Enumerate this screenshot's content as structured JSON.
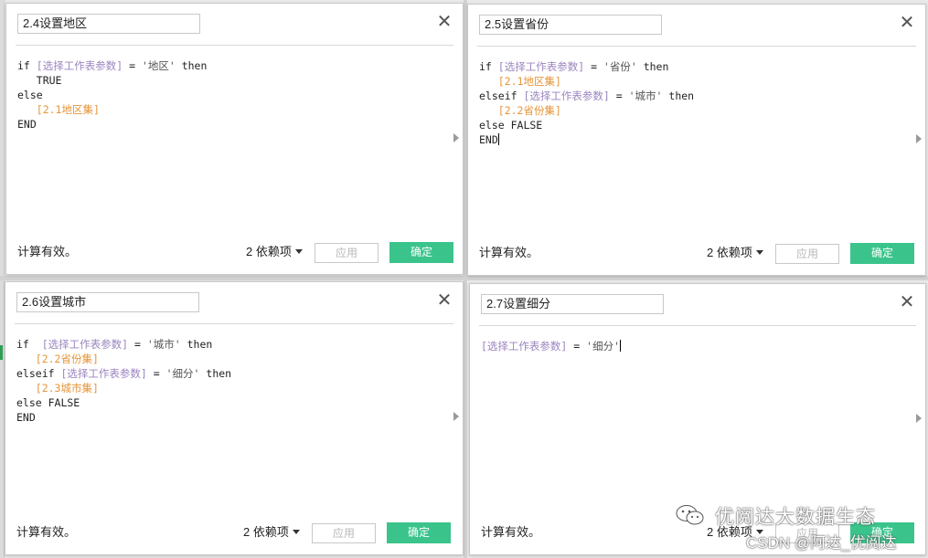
{
  "status_text": "计算有效。",
  "deps_label": "2 依赖项",
  "apply_label": "应用",
  "ok_label": "确定",
  "param_token": "[选择工作表参数]",
  "dialogs": {
    "d1": {
      "title": "2.4设置地区",
      "lines": [
        [
          "if ",
          "[选择工作表参数]",
          " = ",
          "'地区'",
          " then"
        ],
        [
          "   TRUE"
        ],
        [
          "else"
        ],
        [
          "   ",
          "[2.1地区集]"
        ],
        [
          "END"
        ]
      ]
    },
    "d2": {
      "title": "2.5设置省份",
      "lines": [
        [
          "if ",
          "[选择工作表参数]",
          " = ",
          "'省份'",
          " then"
        ],
        [
          "   ",
          "[2.1地区集]"
        ],
        [
          "elseif ",
          "[选择工作表参数]",
          " = ",
          "'城市'",
          " then"
        ],
        [
          "   ",
          "[2.2省份集]"
        ],
        [
          "else FALSE"
        ],
        [
          "END"
        ]
      ]
    },
    "d3": {
      "title": "2.6设置城市",
      "lines": [
        [
          "if  ",
          "[选择工作表参数]",
          " = ",
          "'城市'",
          " then"
        ],
        [
          "   ",
          "[2.2省份集]"
        ],
        [
          "elseif ",
          "[选择工作表参数]",
          " = ",
          "'细分'",
          " then"
        ],
        [
          "   ",
          "[2.3城市集]"
        ],
        [
          "else FALSE"
        ],
        [
          "END"
        ]
      ]
    },
    "d4": {
      "title": "2.7设置细分",
      "lines": [
        [
          "[选择工作表参数]",
          " = ",
          "'细分'"
        ]
      ]
    }
  },
  "watermark": {
    "brand": "优阅达大数据生态",
    "site": "CSDN @阿达_优阅达"
  },
  "colors": {
    "ok_button": "#3ac48c",
    "param": "#9b84bf",
    "field": "#e6953b"
  }
}
